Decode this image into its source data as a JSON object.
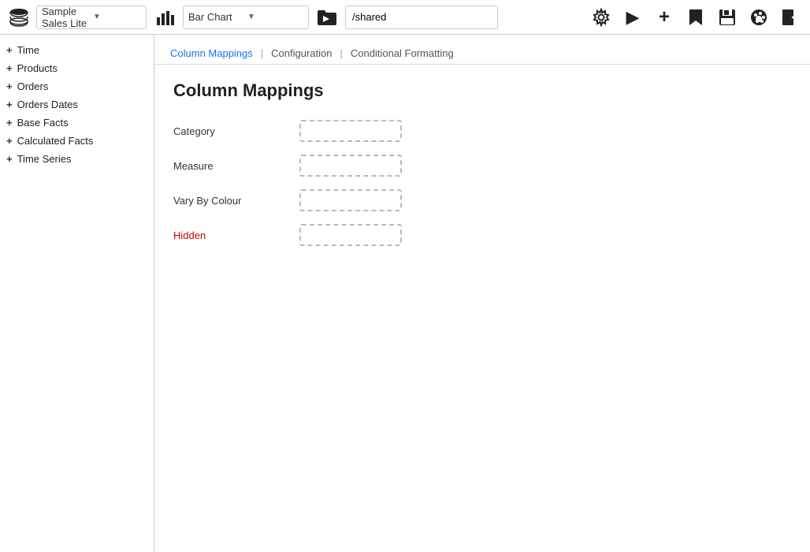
{
  "toolbar": {
    "db_name": "Sample Sales Lite",
    "db_arrow": "▼",
    "chart_type": "Bar Chart",
    "chart_arrow": "▼",
    "path": "/shared"
  },
  "sidebar": {
    "items": [
      {
        "id": "time",
        "label": "Time",
        "icon": "+"
      },
      {
        "id": "products",
        "label": "Products",
        "icon": "+"
      },
      {
        "id": "orders",
        "label": "Orders",
        "icon": "+"
      },
      {
        "id": "orders-dates",
        "label": "Orders Dates",
        "icon": "+"
      },
      {
        "id": "base-facts",
        "label": "Base Facts",
        "icon": "+"
      },
      {
        "id": "calculated-facts",
        "label": "Calculated Facts",
        "icon": "+"
      },
      {
        "id": "time-series",
        "label": "Time Series",
        "icon": "+"
      }
    ]
  },
  "subnav": {
    "links": [
      {
        "id": "column-mappings",
        "label": "Column Mappings",
        "active": true
      },
      {
        "id": "configuration",
        "label": "Configuration",
        "active": false
      },
      {
        "id": "conditional-formatting",
        "label": "Conditional Formatting",
        "active": false
      }
    ]
  },
  "page": {
    "title": "Column Mappings",
    "fields": [
      {
        "id": "category",
        "label": "Category",
        "red": false
      },
      {
        "id": "measure",
        "label": "Measure",
        "red": false
      },
      {
        "id": "vary-by-colour",
        "label": "Vary By Colour",
        "red": false
      },
      {
        "id": "hidden",
        "label": "Hidden",
        "red": true
      }
    ]
  },
  "icons": {
    "settings": "⚙",
    "play": "▶",
    "plus": "+",
    "bookmark": "🔖",
    "save": "💾",
    "palette": "🎨",
    "export": "⬛"
  }
}
